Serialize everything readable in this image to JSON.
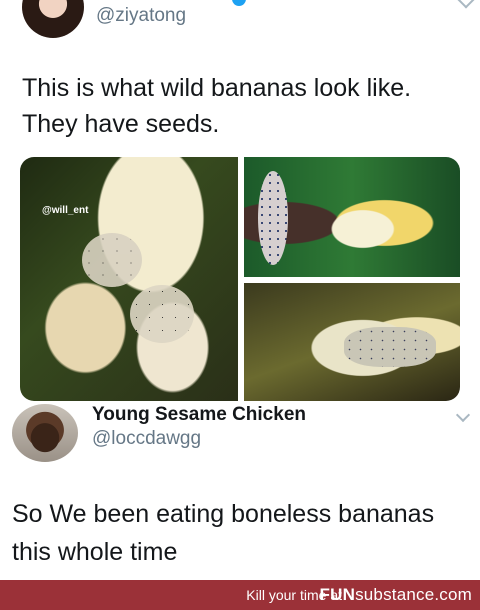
{
  "tweet1": {
    "handle": "@ziyatong",
    "text_line1": "This is what wild bananas look like.",
    "text_line2": "They have seeds.",
    "image_watermark": "@will_ent"
  },
  "tweet2": {
    "display_name": "Young Sesame Chicken",
    "handle": "@loccdawgg",
    "text_line1": "So We been eating boneless bananas",
    "text_line2": "this whole time"
  },
  "footer": {
    "tagline": "Kill your time at",
    "brand_bold": "FUN",
    "brand_rest": "substance.com",
    "bg_color": "#9b3138"
  },
  "icons": [
    "verified-badge-icon",
    "chevron-down-icon"
  ]
}
